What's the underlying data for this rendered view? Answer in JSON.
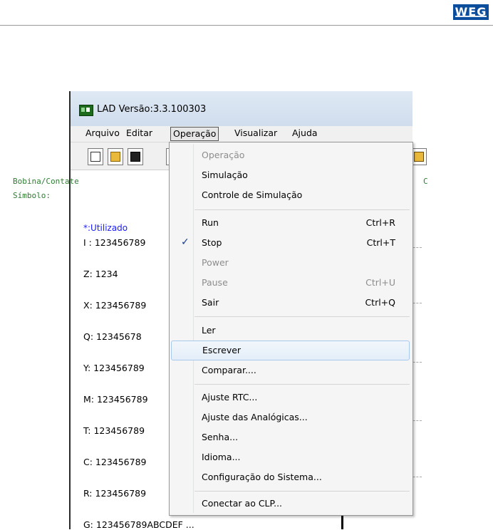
{
  "doc": {
    "logo_text": "WEG"
  },
  "window": {
    "title": "LAD Versão:3.3.100303",
    "menu": [
      "Arquivo",
      "Editar",
      "Operação",
      "Visualizar",
      "Ajuda"
    ]
  },
  "left_panel": {
    "header1": "Bobina/Contate",
    "header2": "Símbolo:",
    "used_label": "*:Utilizado",
    "registers": [
      "I : 123456789",
      "Z: 1234",
      "X: 123456789",
      "Q: 12345678",
      "Y: 123456789",
      "M: 123456789",
      "T: 123456789",
      "C: 123456789",
      "R: 123456789",
      "G: 123456789ABCDEF ..."
    ],
    "right_header": "C"
  },
  "dropdown": {
    "items": [
      {
        "label": "Operação",
        "shortcut": "",
        "disabled": true
      },
      {
        "label": "Simulação",
        "shortcut": ""
      },
      {
        "label": "Controle de Simulação",
        "shortcut": ""
      },
      {
        "label": "Run",
        "shortcut": "Ctrl+R"
      },
      {
        "label": "Stop",
        "shortcut": "Ctrl+T",
        "checked": true
      },
      {
        "label": "Power",
        "shortcut": "",
        "disabled": true
      },
      {
        "label": "Pause",
        "shortcut": "Ctrl+U",
        "disabled": true
      },
      {
        "label": "Sair",
        "shortcut": "Ctrl+Q"
      },
      {
        "label": "Ler",
        "shortcut": ""
      },
      {
        "label": "Escrever",
        "shortcut": "",
        "highlighted": true
      },
      {
        "label": "Comparar....",
        "shortcut": ""
      },
      {
        "label": "Ajuste RTC...",
        "shortcut": ""
      },
      {
        "label": "Ajuste das Analógicas...",
        "shortcut": ""
      },
      {
        "label": "Senha...",
        "shortcut": ""
      },
      {
        "label": "Idioma...",
        "shortcut": ""
      },
      {
        "label": "Configuração do Sistema...",
        "shortcut": ""
      },
      {
        "label": "Conectar ao CLP...",
        "shortcut": ""
      }
    ],
    "check_glyph": "✓"
  }
}
